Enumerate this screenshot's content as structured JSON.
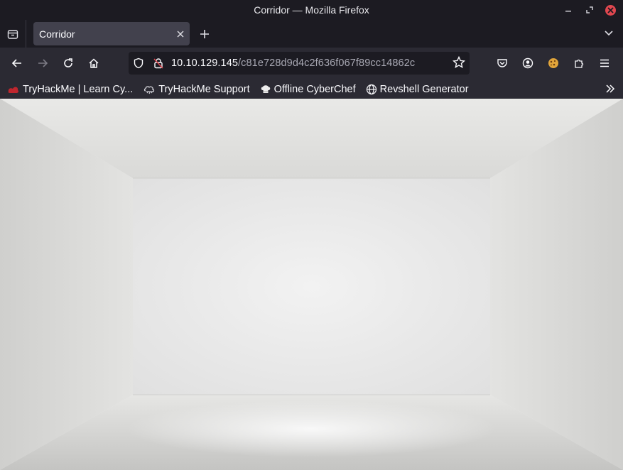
{
  "window": {
    "title": "Corridor — Mozilla Firefox"
  },
  "tabs": [
    {
      "label": "Corridor",
      "active": true
    }
  ],
  "navigation": {
    "url_host": "10.10.129.145",
    "url_path": "/c81e728d9d4c2f636f067f89cc14862c"
  },
  "bookmarks": [
    {
      "label": "TryHackMe | Learn Cy...",
      "icon": "tryhackme-icon"
    },
    {
      "label": "TryHackMe Support",
      "icon": "cloud-icon"
    },
    {
      "label": "Offline CyberChef",
      "icon": "chef-hat-icon"
    },
    {
      "label": "Revshell Generator",
      "icon": "globe-icon"
    }
  ],
  "colors": {
    "titlebar": "#1c1b22",
    "toolbar": "#2b2a33",
    "active_tab": "#42414d",
    "close": "#e0474f"
  }
}
